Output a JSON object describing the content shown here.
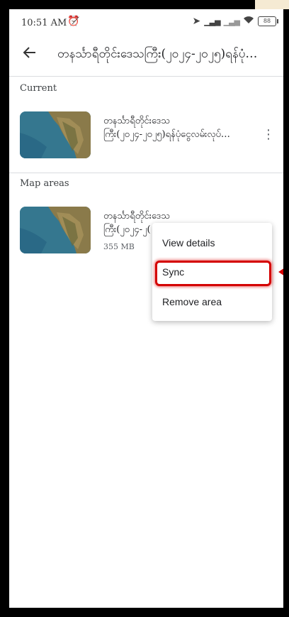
{
  "status_bar": {
    "time": "10:51 AM",
    "battery": "88"
  },
  "app_bar": {
    "title": "တနင်္သာရီတိုင်းဒေသကြီး(၂၀၂၄-၂၀၂၅)ရန်ပုံ…"
  },
  "sections": {
    "current_label": "Current",
    "map_areas_label": "Map areas"
  },
  "current_item": {
    "title_line1": "တနင်္သာရီတိုင်းဒေသ",
    "title_line2": "ကြီး(၂၀၂၄-၂၀၂၅)ရန်ပုံငွေလမ်းလုပ်…"
  },
  "map_area_item": {
    "title_line1": "တနင်္သာရီတိုင်းဒေသ",
    "title_line2": "ကြီး(၂၀၂၄-၂(",
    "size": "355 MB"
  },
  "menu": {
    "items": [
      {
        "label": "View details"
      },
      {
        "label": "Sync"
      },
      {
        "label": "Remove area"
      }
    ]
  },
  "colors": {
    "highlight": "#d40000",
    "divider": "#dadce0"
  }
}
